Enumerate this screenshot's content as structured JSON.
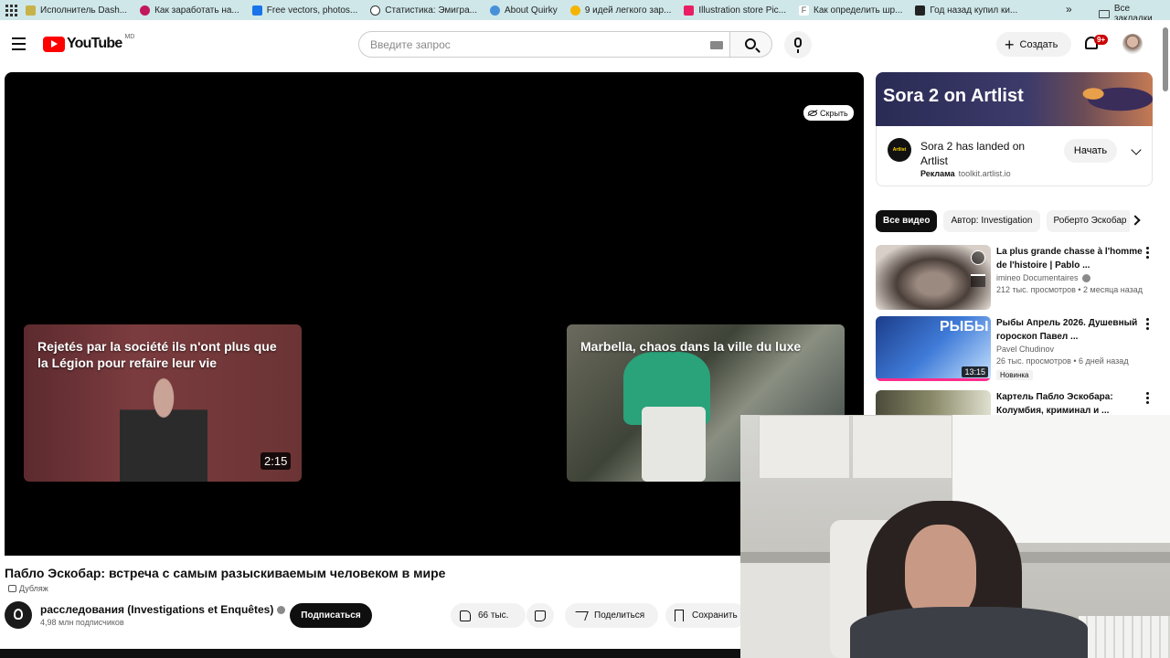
{
  "bookmarks": {
    "items": [
      {
        "label": "Исполнитель Dash...",
        "color": "#c7b24a"
      },
      {
        "label": "Как заработать на...",
        "color": "#c2185b"
      },
      {
        "label": "Free vectors, photos...",
        "color": "#1a73e8"
      },
      {
        "label": "Статистика: Эмигра...",
        "color": "#333333"
      },
      {
        "label": "About  Quirky",
        "color": "#4a90d9"
      },
      {
        "label": "9 идей легкого зар...",
        "color": "#f4b400"
      },
      {
        "label": "Illustration store Pic...",
        "color": "#e91e63"
      },
      {
        "label": "Как определить шр...",
        "color": "#555555"
      },
      {
        "label": "Год назад купил ки...",
        "color": "#222222"
      }
    ],
    "more": "»",
    "all_bookmarks": "Все закладки"
  },
  "header": {
    "logo_text": "YouTube",
    "logo_region": "MD",
    "search_placeholder": "Введите запрос",
    "create_label": "Создать",
    "notifications_badge": "9+"
  },
  "player": {
    "hide_label": "Скрыть",
    "endcards": [
      {
        "title": "Rejetés par la société ils n'ont plus que la Légion pour refaire leur vie",
        "duration": "2:15"
      },
      {
        "title": "Marbella, chaos dans la ville du luxe",
        "duration": ""
      }
    ]
  },
  "video": {
    "title": "Пабло Эскобар: встреча с самым разыскиваемым человеком в мире",
    "dub_label": "Дубляж",
    "channel": "расследования (Investigations et Enquêtes)",
    "subscribers": "4,98 млн подписчиков",
    "subscribe_label": "Подписаться",
    "likes": "66 тыс.",
    "share_label": "Поделиться",
    "save_label": "Сохранить"
  },
  "ad": {
    "banner_text": "Sora 2 on Artlist",
    "title": "Sora 2 has landed on Artlist",
    "sponsored": "Реклама",
    "domain": "toolkit.artlist.io",
    "start_label": "Начать",
    "logo_text": "Artlist"
  },
  "chips": [
    "Все видео",
    "Автор: Investigation",
    "Роберто Эскобар"
  ],
  "recommendations": [
    {
      "title": "La plus grande chasse à l'homme de l'histoire | Pablo ...",
      "channel": "imineo Documentaires",
      "meta": "212 тыс. просмотров • 2 месяца назад",
      "duration": "",
      "badge": ""
    },
    {
      "title": "Рыбы Апрель 2026. Душевный гороскоп Павел ...",
      "channel": "Pavel Chudinov",
      "meta": "26 тыс. просмотров • 6 дней назад",
      "duration": "13:15",
      "badge": "Новинка",
      "thumb_label": "РЫБЫ"
    },
    {
      "title": "Картель Пабло Эскобара: Колумбия, криминал и ...",
      "channel": "",
      "meta": "",
      "duration": "",
      "badge": ""
    }
  ]
}
